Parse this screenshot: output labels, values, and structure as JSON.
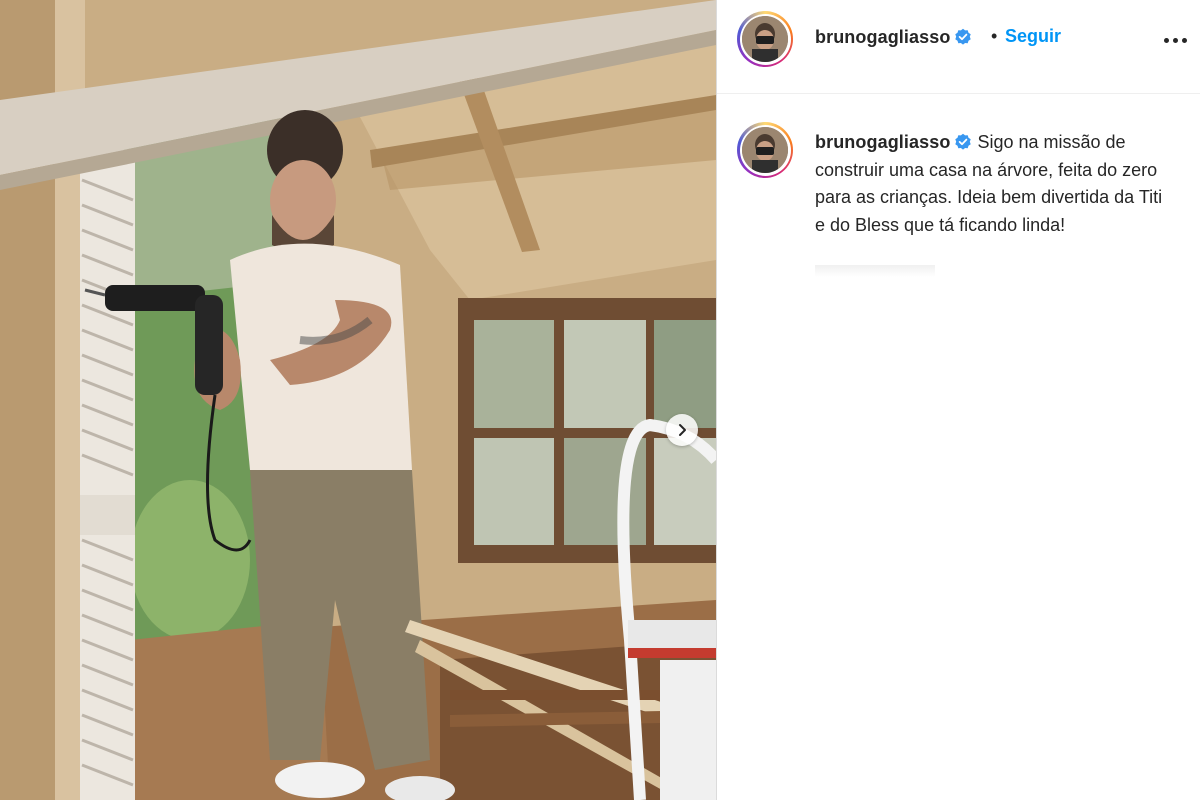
{
  "post": {
    "username": "brunogagliasso",
    "follow_label": "Seguir",
    "separator": "•",
    "caption_text": "Sigo na missão de construir uma casa na árvore, feita do zero para as crianças. Ideia bem divertida da Titi e do Bless que tá ficando linda!"
  },
  "icons": {
    "verified": "verified-badge-icon",
    "more": "more-options-icon",
    "next": "chevron-right-icon"
  },
  "colors": {
    "link_blue": "#0095f6",
    "text": "#262626",
    "verified_blue": "#3897f0"
  }
}
